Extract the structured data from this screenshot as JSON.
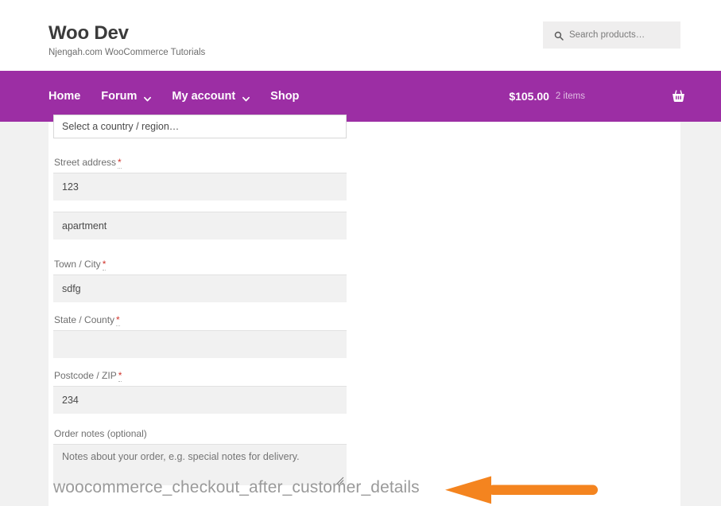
{
  "header": {
    "brand_title": "Woo Dev",
    "brand_tagline": "Njengah.com WooCommerce Tutorials",
    "search_placeholder": "Search products…",
    "search_value": "",
    "search_icon": "search-icon"
  },
  "nav": {
    "items": [
      {
        "label": "Home",
        "has_caret": false
      },
      {
        "label": "Forum",
        "has_caret": true
      },
      {
        "label": "My account",
        "has_caret": true
      },
      {
        "label": "Shop",
        "has_caret": false
      }
    ],
    "cart": {
      "total": "$105.00",
      "count": "2 items",
      "icon": "shopping-basket-icon"
    }
  },
  "checkout": {
    "country": {
      "label": "",
      "selected": "Select a country / region…"
    },
    "street_address": {
      "label": "Street address",
      "required_mark": "*",
      "value": "123"
    },
    "address_line_2": {
      "value": "apartment"
    },
    "town_city": {
      "label": "Town / City",
      "required_mark": "*",
      "value": "sdfg"
    },
    "state_county": {
      "label": "State / County",
      "required_mark": "*",
      "value": ""
    },
    "postcode_zip": {
      "label": "Postcode / ZIP",
      "required_mark": "*",
      "value": "234"
    },
    "order_notes": {
      "label": "Order notes (optional)",
      "placeholder": "Notes about your order, e.g. special notes for delivery.",
      "value": ""
    }
  },
  "annotation": {
    "hook_name": "woocommerce_checkout_after_customer_details",
    "arrow_color": "#F4841F",
    "arrow_direction": "left"
  },
  "colors": {
    "nav_purple": "#9C2EA4",
    "page_background": "#F1F1F1",
    "panel_white": "#FFFFFF",
    "field_fill": "#F1F1F1",
    "required_red": "#D0342C",
    "hook_text_gray": "#9A9A9A"
  }
}
